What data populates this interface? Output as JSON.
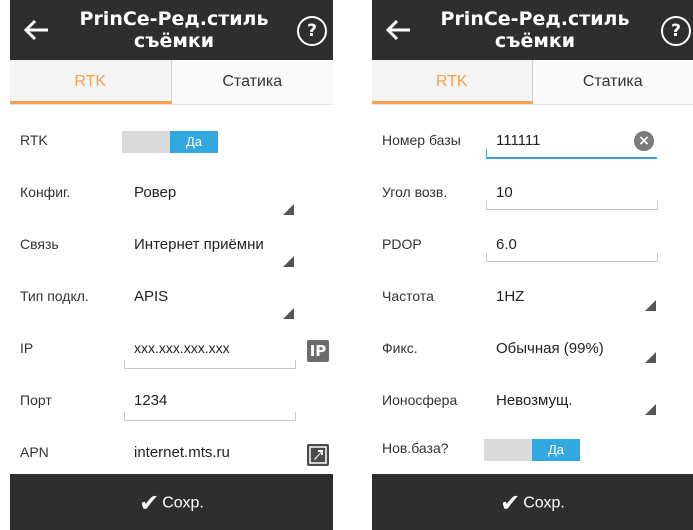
{
  "left": {
    "title": "PrinCe-Ред.стиль съёмки",
    "tabs": [
      "RTK",
      "Статика"
    ],
    "rows": [
      {
        "label": "RTK",
        "toggle": "Да"
      },
      {
        "label": "Конфиг.",
        "value": "Ровер"
      },
      {
        "label": "Связь",
        "value": "Интернет приёмни"
      },
      {
        "label": "Тип подкл.",
        "value": "APIS"
      },
      {
        "label": "IP",
        "value": "xxx.xxx.xxx.xxx",
        "button": "IP"
      },
      {
        "label": "Порт",
        "value": "1234"
      },
      {
        "label": "APN",
        "value": "internet.mts.ru"
      }
    ],
    "save": "Сохр."
  },
  "right": {
    "title": "PrinCe-Ред.стиль съёмки",
    "tabs": [
      "RTK",
      "Статика"
    ],
    "rows": [
      {
        "label": "Номер базы",
        "value": "111111"
      },
      {
        "label": "Угол возв.",
        "value": "10"
      },
      {
        "label": "PDOP",
        "value": "6.0"
      },
      {
        "label": "Частота",
        "value": "1HZ"
      },
      {
        "label": "Фикс.",
        "value": "Обычная (99%)"
      },
      {
        "label": "Ионосфера",
        "value": "Невозмущ."
      },
      {
        "label": "Нов.база?",
        "toggle": "Да"
      }
    ],
    "save": "Сохр."
  },
  "icons": {
    "back": "back-arrow-icon",
    "help": "help-icon",
    "check": "checkmark-icon",
    "clear": "clear-icon",
    "external": "external-link-icon"
  },
  "colors": {
    "accent": "#f2a24a",
    "toggle_on": "#33a7e0",
    "bar": "#2e2e2e"
  }
}
